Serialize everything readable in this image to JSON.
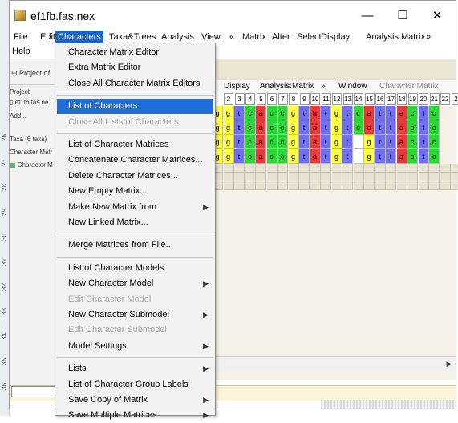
{
  "window": {
    "title": "ef1fb.fas.nex",
    "minimize": "—",
    "maximize": "☐",
    "close": "✕"
  },
  "menubar": {
    "items": [
      "File",
      "Edit",
      "Characters",
      "Taxa&Trees",
      "Analysis",
      "View",
      "«",
      "Matrix",
      "Alter",
      "Select",
      "Display",
      "Analysis:Matrix",
      "»"
    ],
    "help": "Help",
    "active": "Characters"
  },
  "left_panel": {
    "project_of": "Project of",
    "project_label": "Project",
    "file": "ef1fb.fas.ne",
    "add": "Add...",
    "taxa": "Taxa (6 taxa)",
    "char_matrices": "Character Matr",
    "char_matrix_item": "Character M"
  },
  "inner_menu": {
    "display": "Display",
    "analysis_matrix": "Analysis:Matrix",
    "more": "»",
    "window": "Window",
    "character_matrix": "Character Matrix"
  },
  "columns": [
    "2",
    "3",
    "4",
    "5",
    "6",
    "7",
    "8",
    "9",
    "10",
    "11",
    "12",
    "13",
    "14",
    "15",
    "16",
    "17",
    "18",
    "19",
    "20",
    "21",
    "22",
    "2"
  ],
  "matrix_rows": [
    [
      "g",
      "g",
      "t",
      "c",
      "a",
      "c",
      "c",
      "g",
      "t",
      "a",
      "t",
      "g",
      "t",
      "c",
      "a",
      "t",
      "t",
      "a",
      "c",
      "t",
      "c"
    ],
    [
      "g",
      "g",
      "t",
      "c",
      "a",
      "c",
      "c",
      "g",
      "t",
      "a",
      "t",
      "g",
      "t",
      "c",
      "a",
      "t",
      "t",
      "a",
      "c",
      "t",
      "c"
    ],
    [
      "g",
      "g",
      "t",
      "c",
      "a",
      "c",
      "c",
      "g",
      "t",
      "a",
      "t",
      "g",
      "t",
      "",
      "g",
      "t",
      "t",
      "a",
      "c",
      "t",
      "c"
    ],
    [
      "g",
      "g",
      "t",
      "c",
      "a",
      "c",
      "c",
      "g",
      "t",
      "a",
      "t",
      "g",
      "t",
      "",
      "g",
      "t",
      "t",
      "a",
      "c",
      "t",
      "c"
    ]
  ],
  "base_colors": {
    "a": "#e8383b",
    "c": "#2fd43a",
    "g": "#ffff45",
    "t": "#6f6ff0",
    "": "#ffffff"
  },
  "row_numbers": [
    "26",
    "27",
    "28",
    "29",
    "30",
    "31",
    "32",
    "33",
    "34",
    "35",
    "36"
  ],
  "dropdown": {
    "groups": [
      [
        {
          "label": "Character Matrix Editor",
          "state": "normal",
          "submenu": false
        },
        {
          "label": "Extra Matrix Editor",
          "state": "normal",
          "submenu": false
        },
        {
          "label": "Close All Character Matrix Editors",
          "state": "normal",
          "submenu": false
        }
      ],
      [
        {
          "label": "List of Characters",
          "state": "highlighted",
          "submenu": false
        },
        {
          "label": "Close All Lists of Characters",
          "state": "disabled",
          "submenu": false
        }
      ],
      [
        {
          "label": "List of Character Matrices",
          "state": "normal",
          "submenu": false
        },
        {
          "label": "Concatenate Character Matrices...",
          "state": "normal",
          "submenu": false
        },
        {
          "label": "Delete Character Matrices...",
          "state": "normal",
          "submenu": false
        },
        {
          "label": "New Empty Matrix...",
          "state": "normal",
          "submenu": false
        },
        {
          "label": "Make New Matrix from",
          "state": "normal",
          "submenu": true
        },
        {
          "label": "New Linked Matrix...",
          "state": "normal",
          "submenu": false
        }
      ],
      [
        {
          "label": "Merge Matrices from File...",
          "state": "normal",
          "submenu": false
        }
      ],
      [
        {
          "label": "List of Character Models",
          "state": "normal",
          "submenu": false
        },
        {
          "label": "New Character Model",
          "state": "normal",
          "submenu": true
        },
        {
          "label": "Edit Character Model",
          "state": "disabled",
          "submenu": false
        },
        {
          "label": "New Character Submodel",
          "state": "normal",
          "submenu": true
        },
        {
          "label": "Edit Character Submodel",
          "state": "disabled",
          "submenu": false
        },
        {
          "label": "Model Settings",
          "state": "normal",
          "submenu": true
        }
      ],
      [
        {
          "label": "Lists",
          "state": "normal",
          "submenu": true
        },
        {
          "label": "List of Character Group Labels",
          "state": "normal",
          "submenu": false
        },
        {
          "label": "Save Copy of Matrix",
          "state": "normal",
          "submenu": true
        },
        {
          "label": "Save Multiple Matrices",
          "state": "normal",
          "submenu": true
        }
      ]
    ]
  }
}
